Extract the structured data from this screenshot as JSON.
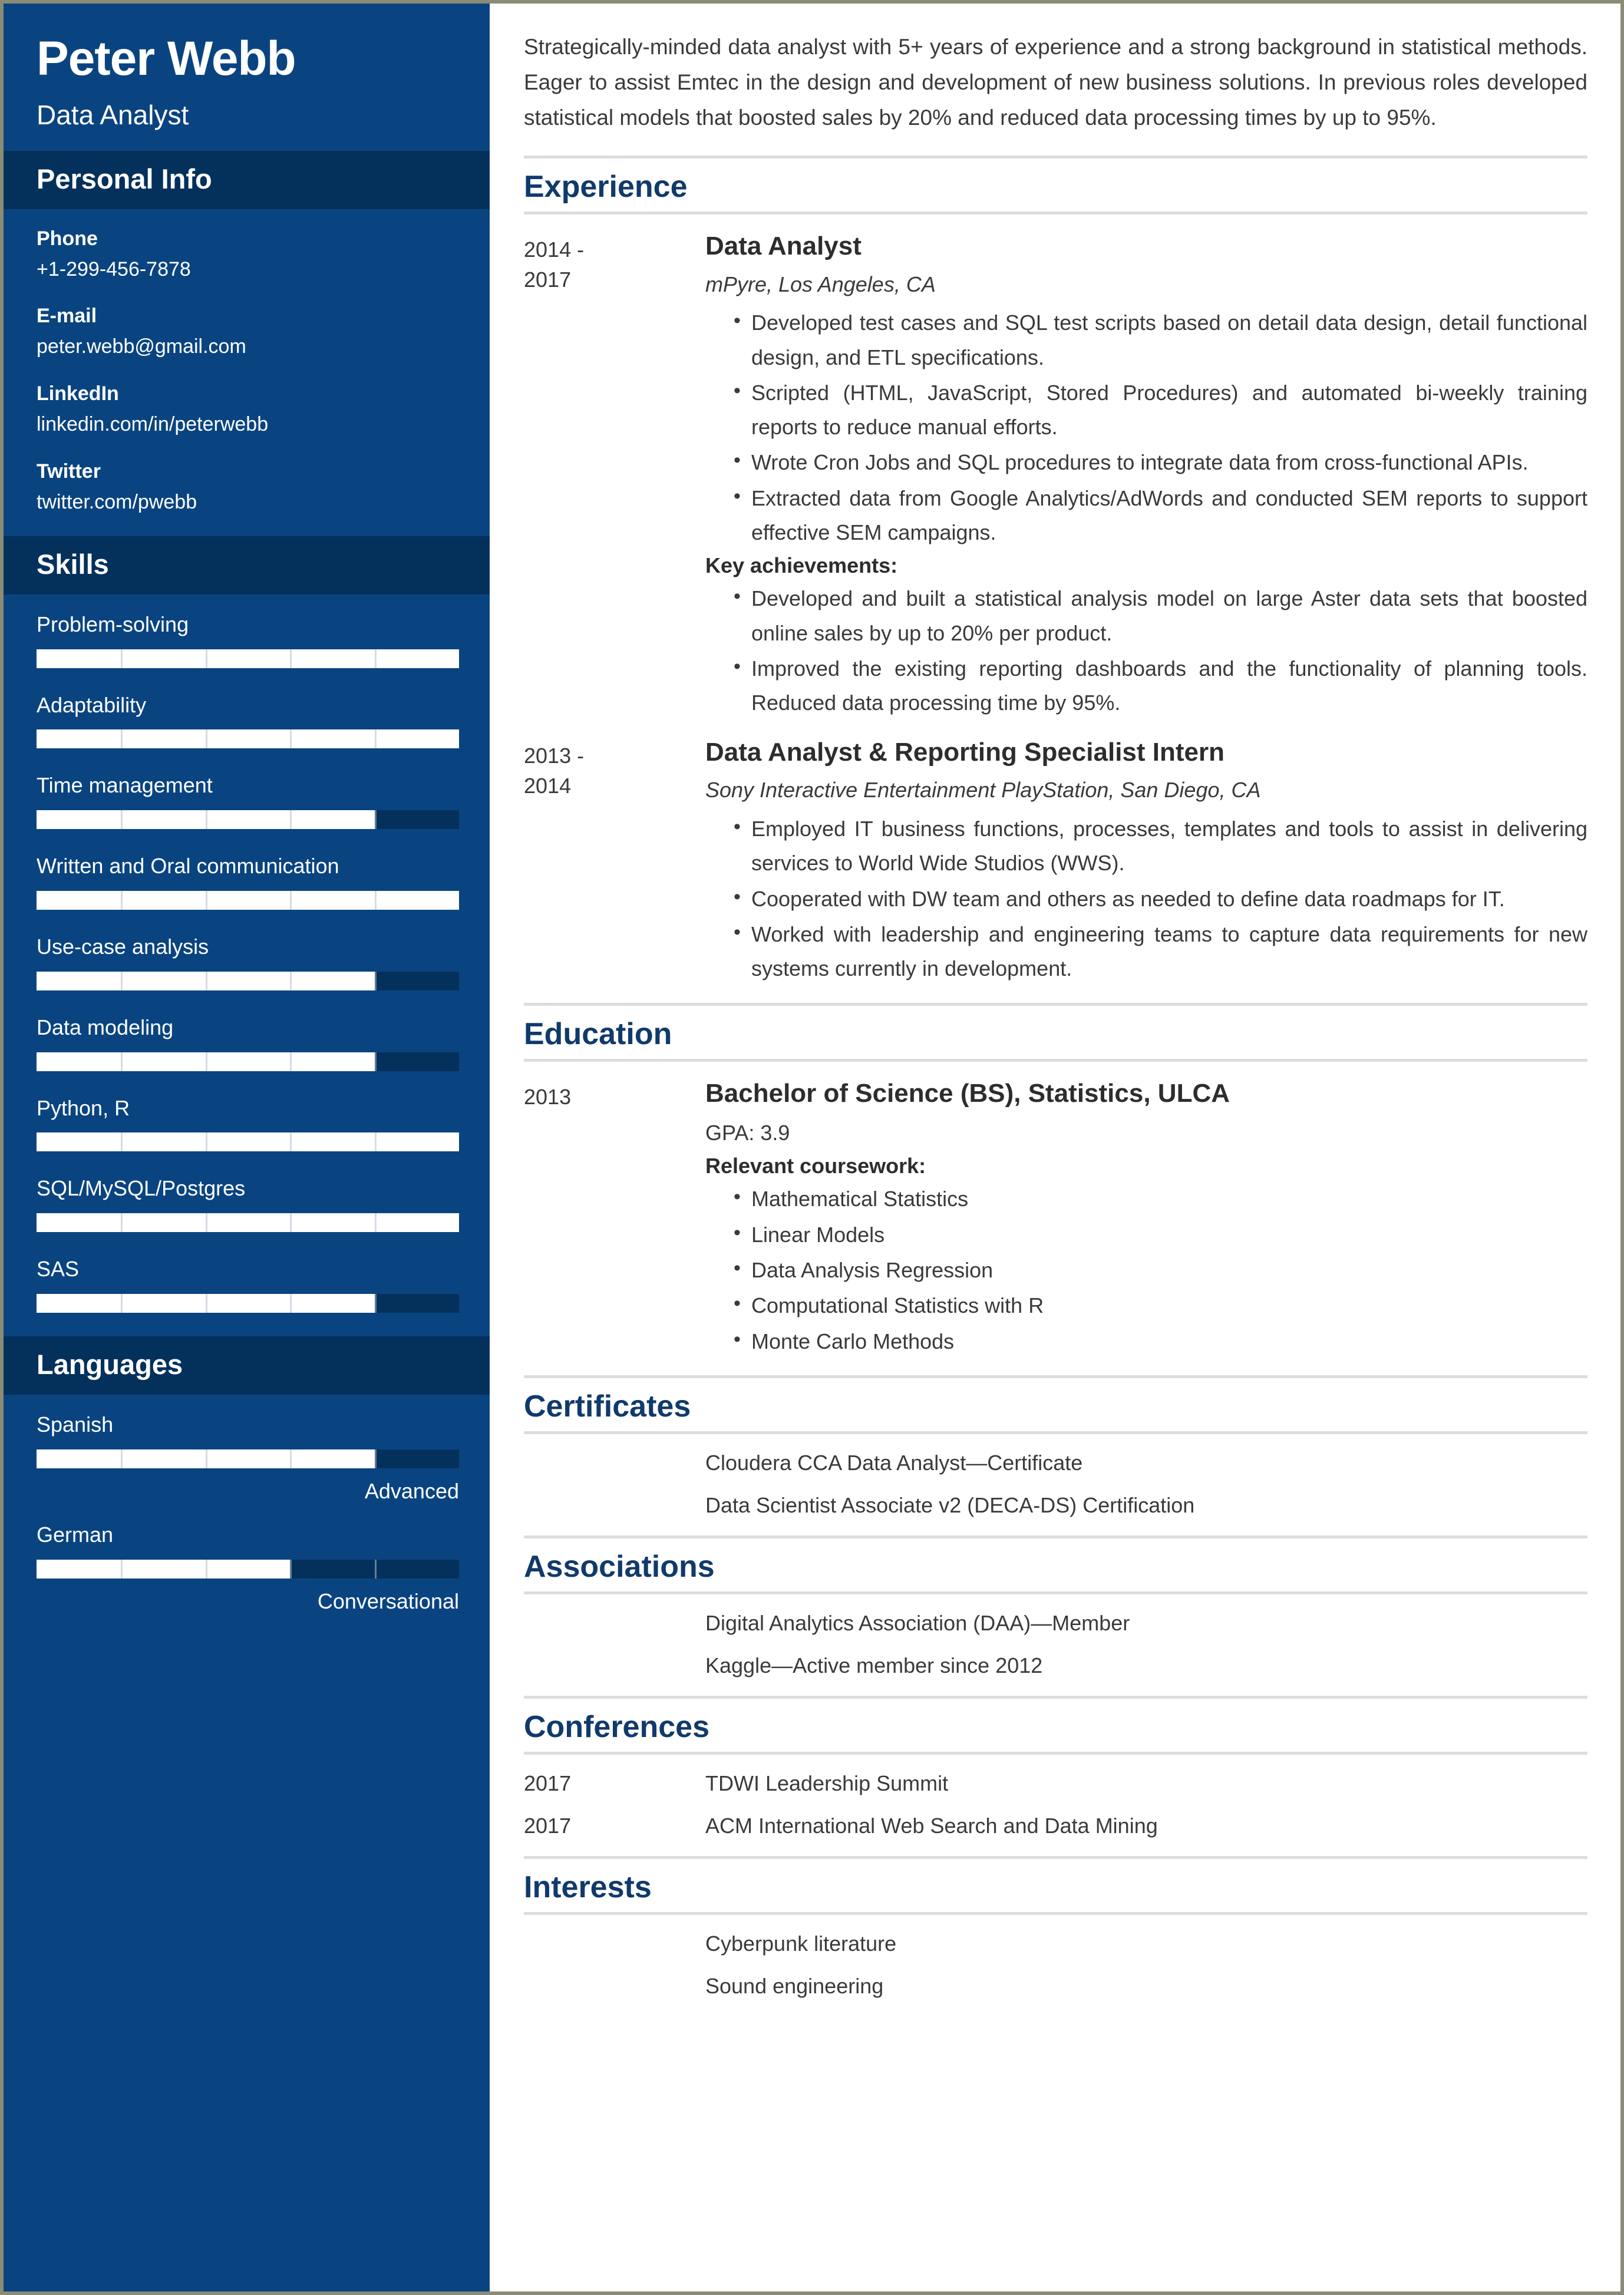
{
  "colors": {
    "sidebar_bg": "#0a4480",
    "sidebar_header_bg": "#04305c",
    "bar_track": "#04315c",
    "bar_fill": "#ffffff",
    "section_title": "#103a6b",
    "page_border": "#8a8c76"
  },
  "sidebar": {
    "name": "Peter Webb",
    "title": "Data Analyst",
    "personal_info_heading": "Personal Info",
    "contacts": [
      {
        "label": "Phone",
        "value": "+1-299-456-7878"
      },
      {
        "label": "E-mail",
        "value": "peter.webb@gmail.com"
      },
      {
        "label": "LinkedIn",
        "value": "linkedin.com/in/peterwebb"
      },
      {
        "label": "Twitter",
        "value": "twitter.com/pwebb"
      }
    ],
    "skills_heading": "Skills",
    "skills": [
      {
        "label": "Problem-solving",
        "value": 100
      },
      {
        "label": "Adaptability",
        "value": 100
      },
      {
        "label": "Time management",
        "value": 80
      },
      {
        "label": "Written and Oral communication",
        "value": 100
      },
      {
        "label": "Use-case analysis",
        "value": 80
      },
      {
        "label": "Data modeling",
        "value": 80
      },
      {
        "label": "Python, R",
        "value": 100
      },
      {
        "label": "SQL/MySQL/Postgres",
        "value": 100
      },
      {
        "label": "SAS",
        "value": 80
      }
    ],
    "languages_heading": "Languages",
    "languages": [
      {
        "label": "Spanish",
        "value": 80,
        "level": "Advanced"
      },
      {
        "label": "German",
        "value": 60,
        "level": "Conversational"
      }
    ]
  },
  "main": {
    "summary": "Strategically-minded data analyst with 5+ years of experience and a strong background in statistical methods. Eager to assist Emtec in the design and development of new business solutions. In previous roles developed statistical models that boosted sales by 20% and reduced data processing times by up to 95%.",
    "experience": {
      "heading": "Experience",
      "entries": [
        {
          "date": "2014 -\n2017",
          "role": "Data Analyst",
          "company": "mPyre, Los Angeles, CA",
          "bullets": [
            "Developed test cases and SQL test scripts based on detail data design, detail functional design, and ETL specifications.",
            "Scripted (HTML, JavaScript, Stored Procedures) and automated bi-weekly training reports to reduce manual efforts.",
            "Wrote Cron Jobs and SQL procedures to integrate data from cross-functional APIs.",
            "Extracted data from Google Analytics/AdWords and conducted SEM reports to support effective SEM campaigns."
          ],
          "achievements_heading": "Key achievements:",
          "achievements": [
            "Developed and built a statistical analysis model on large Aster data sets that boosted online sales by up to 20% per product.",
            "Improved the existing reporting dashboards and the functionality of planning tools. Reduced data processing time by 95%."
          ]
        },
        {
          "date": "2013 -\n2014",
          "role": "Data Analyst & Reporting Specialist Intern",
          "company": "Sony Interactive Entertainment PlayStation, San Diego, CA",
          "bullets": [
            "Employed IT business functions, processes, templates and tools to assist in delivering services to World Wide Studios (WWS).",
            "Cooperated with DW team and others as needed to define data roadmaps for IT.",
            "Worked with leadership and engineering teams to capture data requirements for new systems currently in development."
          ],
          "achievements_heading": "",
          "achievements": []
        }
      ]
    },
    "education": {
      "heading": "Education",
      "date": "2013",
      "degree": "Bachelor of Science (BS), Statistics, ULCA",
      "gpa": "GPA: 3.9",
      "coursework_heading": "Relevant coursework:",
      "coursework": [
        "Mathematical Statistics",
        "Linear Models",
        "Data Analysis Regression",
        "Computational Statistics with R",
        "Monte Carlo Methods"
      ]
    },
    "certificates": {
      "heading": "Certificates",
      "items": [
        "Cloudera CCA Data Analyst—Certificate",
        "Data Scientist Associate v2 (DECA-DS) Certification"
      ]
    },
    "associations": {
      "heading": "Associations",
      "items": [
        "Digital Analytics Association (DAA)—Member",
        "Kaggle—Active member since 2012"
      ]
    },
    "conferences": {
      "heading": "Conferences",
      "items": [
        {
          "date": "2017",
          "text": "TDWI Leadership Summit"
        },
        {
          "date": "2017",
          "text": "ACM International Web Search and Data Mining"
        }
      ]
    },
    "interests": {
      "heading": "Interests",
      "items": [
        "Cyberpunk literature",
        "Sound engineering"
      ]
    }
  }
}
